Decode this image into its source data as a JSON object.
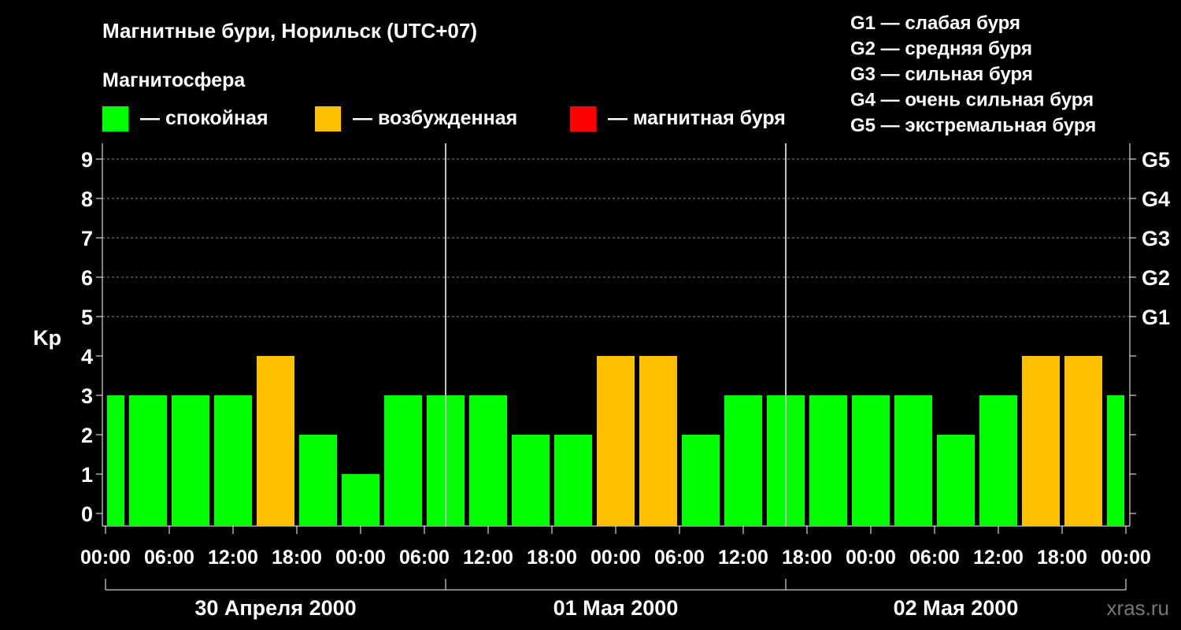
{
  "chart_data": {
    "type": "bar",
    "title": "Магнитные бури, Норильск (UTC+07)",
    "ylabel": "Kp",
    "ylim": [
      0,
      9
    ],
    "yticks": [
      "0",
      "1",
      "2",
      "3",
      "4",
      "5",
      "6",
      "7",
      "8",
      "9"
    ],
    "storm_levels": [
      {
        "label": "G1",
        "kp": 5
      },
      {
        "label": "G2",
        "kp": 6
      },
      {
        "label": "G3",
        "kp": 7
      },
      {
        "label": "G4",
        "kp": 8
      },
      {
        "label": "G5",
        "kp": 9
      }
    ],
    "storm_legend": [
      "G1 — слабая буря",
      "G2 — средняя буря",
      "G3 — сильная буря",
      "G4 — очень сильная буря",
      "G5 — экстремальная буря"
    ],
    "magnetosphere_title": "Магнитосфера",
    "magnetosphere_legend": [
      {
        "label": "— спокойная",
        "color": "#00ff00"
      },
      {
        "label": "— возбужденная",
        "color": "#ffc000"
      },
      {
        "label": "— магнитная буря",
        "color": "#ff0000"
      }
    ],
    "x_tick_labels": [
      "00:00",
      "06:00",
      "12:00",
      "18:00",
      "00:00",
      "06:00",
      "12:00",
      "18:00",
      "00:00",
      "06:00",
      "12:00",
      "18:00",
      "00:00",
      "06:00",
      "12:00",
      "18:00",
      "00:00"
    ],
    "days": [
      "30 Апреля 2000",
      "01 Мая 2000",
      "02 Мая 2000"
    ],
    "values": [
      3,
      3,
      3,
      3,
      4,
      2,
      1,
      3,
      3,
      3,
      2,
      2,
      4,
      4,
      2,
      3,
      3,
      3,
      3,
      3,
      2,
      3,
      4,
      4,
      3
    ],
    "colors": {
      "quiet": "#00ff00",
      "active": "#ffc000",
      "storm": "#ff0000"
    },
    "grid": "dashed at Kp 5-9",
    "watermark": "xras.ru"
  }
}
